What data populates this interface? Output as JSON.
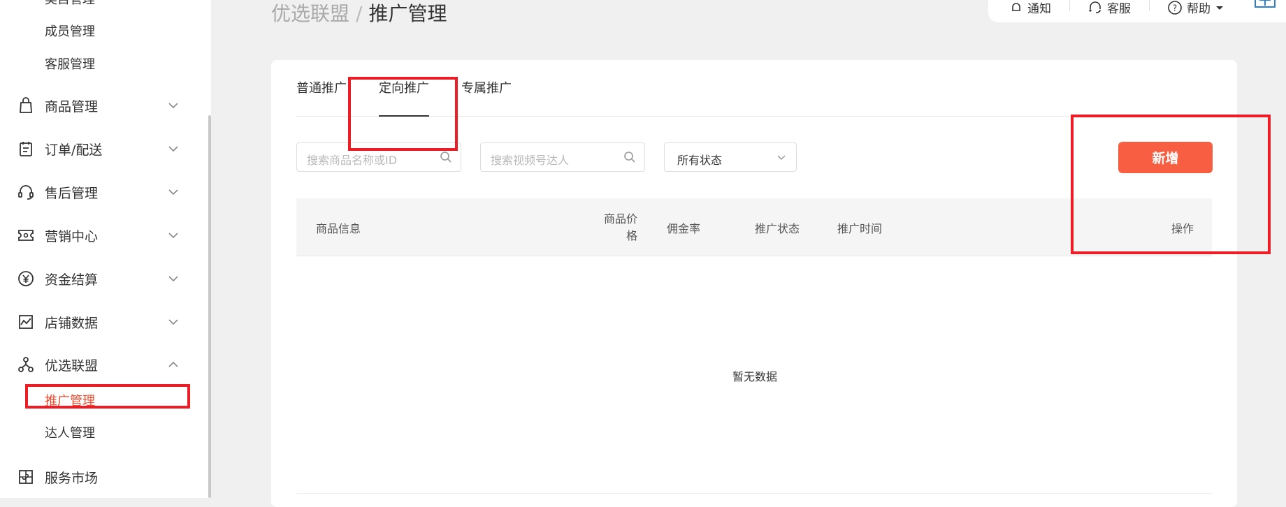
{
  "sidebar": {
    "sub_top": [
      "类目管理",
      "成员管理",
      "客服管理"
    ],
    "menu": [
      {
        "label": "商品管理",
        "icon": "shopping-bag-icon"
      },
      {
        "label": "订单/配送",
        "icon": "order-list-icon"
      },
      {
        "label": "售后管理",
        "icon": "headset-icon"
      },
      {
        "label": "营销中心",
        "icon": "ticket-icon"
      },
      {
        "label": "资金结算",
        "icon": "yuan-circle-icon"
      },
      {
        "label": "店铺数据",
        "icon": "chart-icon"
      },
      {
        "label": "优选联盟",
        "icon": "alliance-icon"
      },
      {
        "label": "服务市场",
        "icon": "puzzle-icon"
      }
    ],
    "alliance_sub": [
      "推广管理",
      "达人管理"
    ]
  },
  "header": {
    "breadcrumb_parent": "优选联盟",
    "breadcrumb_sep": "/",
    "breadcrumb_current": "推广管理",
    "notify": "通知",
    "service": "客服",
    "help": "帮助"
  },
  "tabs": [
    "普通推广",
    "定向推广",
    "专属推广"
  ],
  "filters": {
    "product_search_placeholder": "搜索商品名称或ID",
    "talent_search_placeholder": "搜索视频号达人",
    "status_value": "所有状态"
  },
  "add_button": "新增",
  "table": {
    "headers": {
      "info": "商品信息",
      "price_line1": "商品价",
      "price_line2": "格",
      "commission": "佣金率",
      "status": "推广状态",
      "time": "推广时间",
      "action": "操作"
    },
    "empty_text": "暂无数据"
  },
  "colors": {
    "accent": "#f85f42",
    "annotation": "#ee1c25"
  }
}
